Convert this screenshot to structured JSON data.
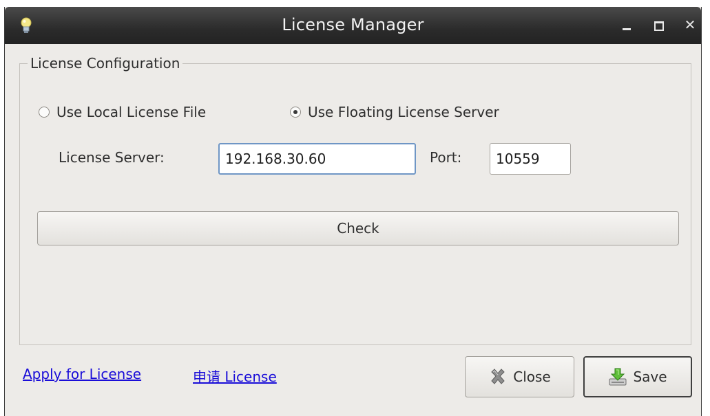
{
  "window": {
    "title": "License Manager",
    "icon": "lightbulb-icon"
  },
  "group": {
    "label": "License Configuration",
    "radio_local": {
      "label": "Use Local License File",
      "checked": false
    },
    "radio_floating": {
      "label": "Use Floating License Server",
      "checked": true
    },
    "server_label": "License Server:",
    "server_value": "192.168.30.60",
    "port_label": "Port:",
    "port_value": "10559",
    "check_label": "Check"
  },
  "footer": {
    "apply_link": "Apply for License",
    "apply_link_cn": "申请 License",
    "close_label": "Close",
    "save_label": "Save"
  },
  "colors": {
    "window_bg": "#edebe8",
    "titlebar": "#2b2b2b",
    "link": "#1a0dd8",
    "focus_border": "#6f96c5"
  }
}
